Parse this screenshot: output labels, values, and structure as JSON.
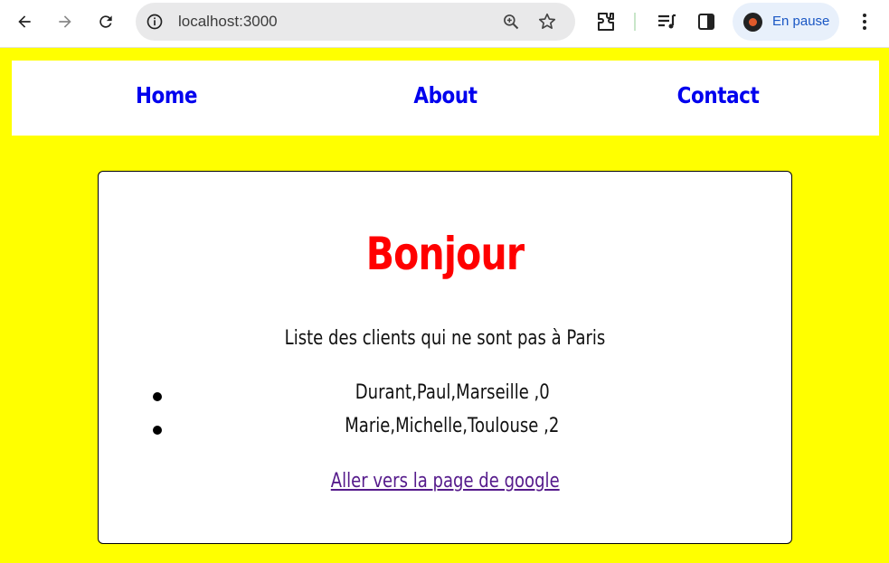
{
  "browser": {
    "url": "localhost:3000",
    "profile_label": "En pause"
  },
  "nav": {
    "home": "Home",
    "about": "About",
    "contact": "Contact"
  },
  "card": {
    "title": "Bonjour",
    "subtitle": "Liste des clients qui ne sont pas à Paris",
    "clients": [
      "Durant,Paul,Marseille ,0",
      "Marie,Michelle,Toulouse ,2"
    ],
    "link_label": "Aller vers la page de google"
  },
  "colors": {
    "page_background": "#ffff00",
    "title": "#ff0000",
    "nav_link": "#0000ee",
    "visited_link": "#551a8b"
  }
}
